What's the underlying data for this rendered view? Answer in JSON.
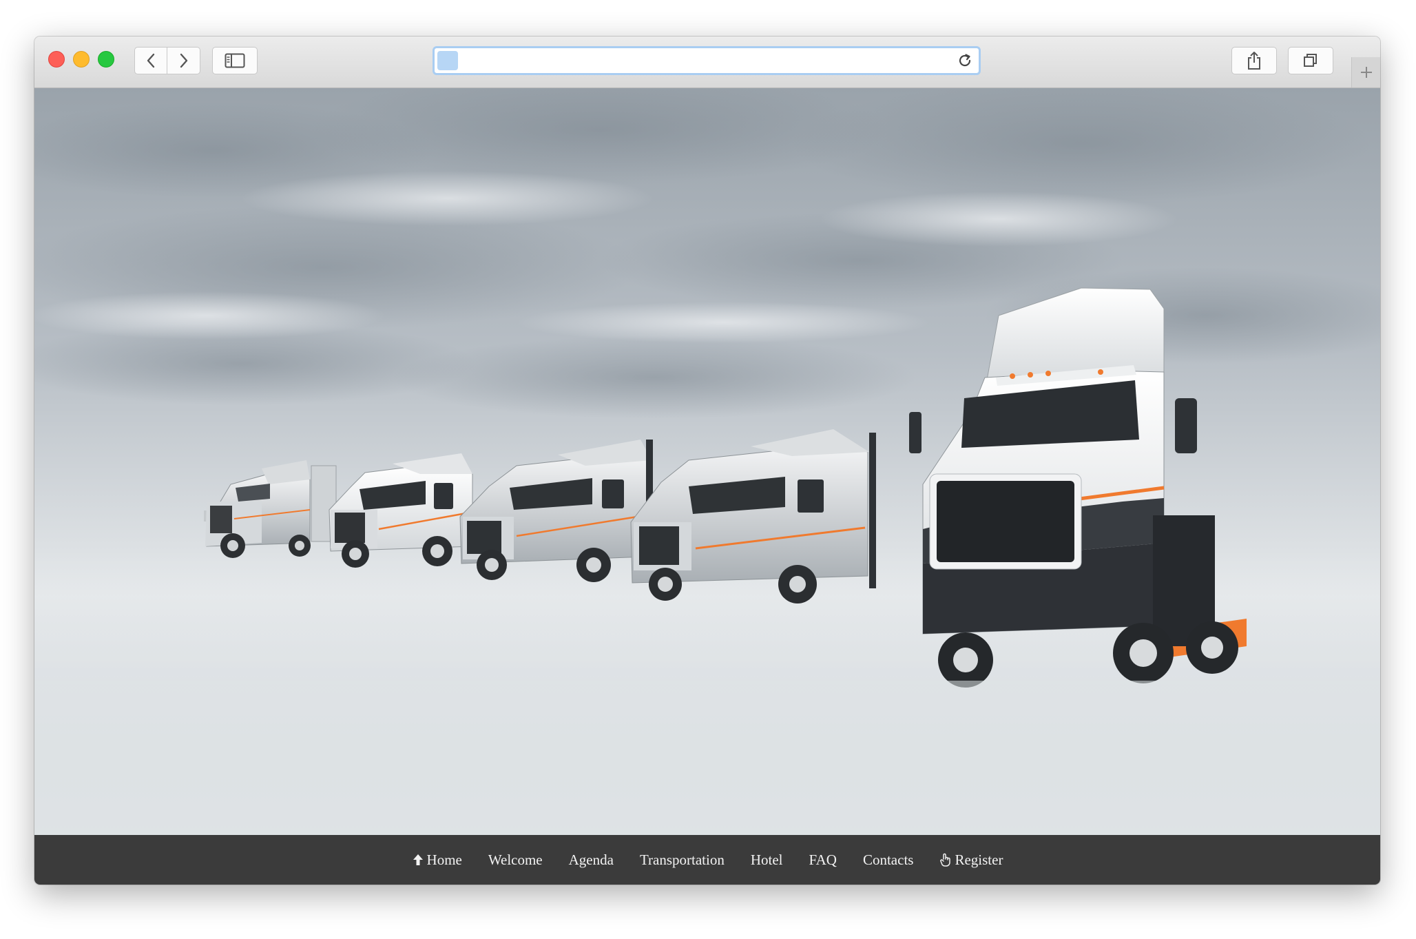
{
  "browser": {
    "url": "",
    "buttons": {
      "back_icon": "chevron-left-icon",
      "forward_icon": "chevron-right-icon",
      "sidebar_icon": "sidebar-icon",
      "reload_icon": "reload-icon",
      "share_icon": "share-icon",
      "tabs_icon": "tab-overview-icon",
      "new_tab_icon": "plus-icon"
    }
  },
  "hero": {
    "image": "fleet-of-semi-trucks",
    "description_colors": {
      "sky": "#c9cfd4",
      "truck_accent": "#f07a2e",
      "truck_dark": "#2e3136"
    }
  },
  "nav": {
    "background": "#3b3b3b",
    "items": [
      {
        "label": "Home",
        "icon": "arrow-up-icon"
      },
      {
        "label": "Welcome"
      },
      {
        "label": "Agenda"
      },
      {
        "label": "Transportation"
      },
      {
        "label": "Hotel"
      },
      {
        "label": "FAQ"
      },
      {
        "label": "Contacts"
      },
      {
        "label": "Register",
        "icon": "hand-pointer-icon"
      }
    ]
  }
}
